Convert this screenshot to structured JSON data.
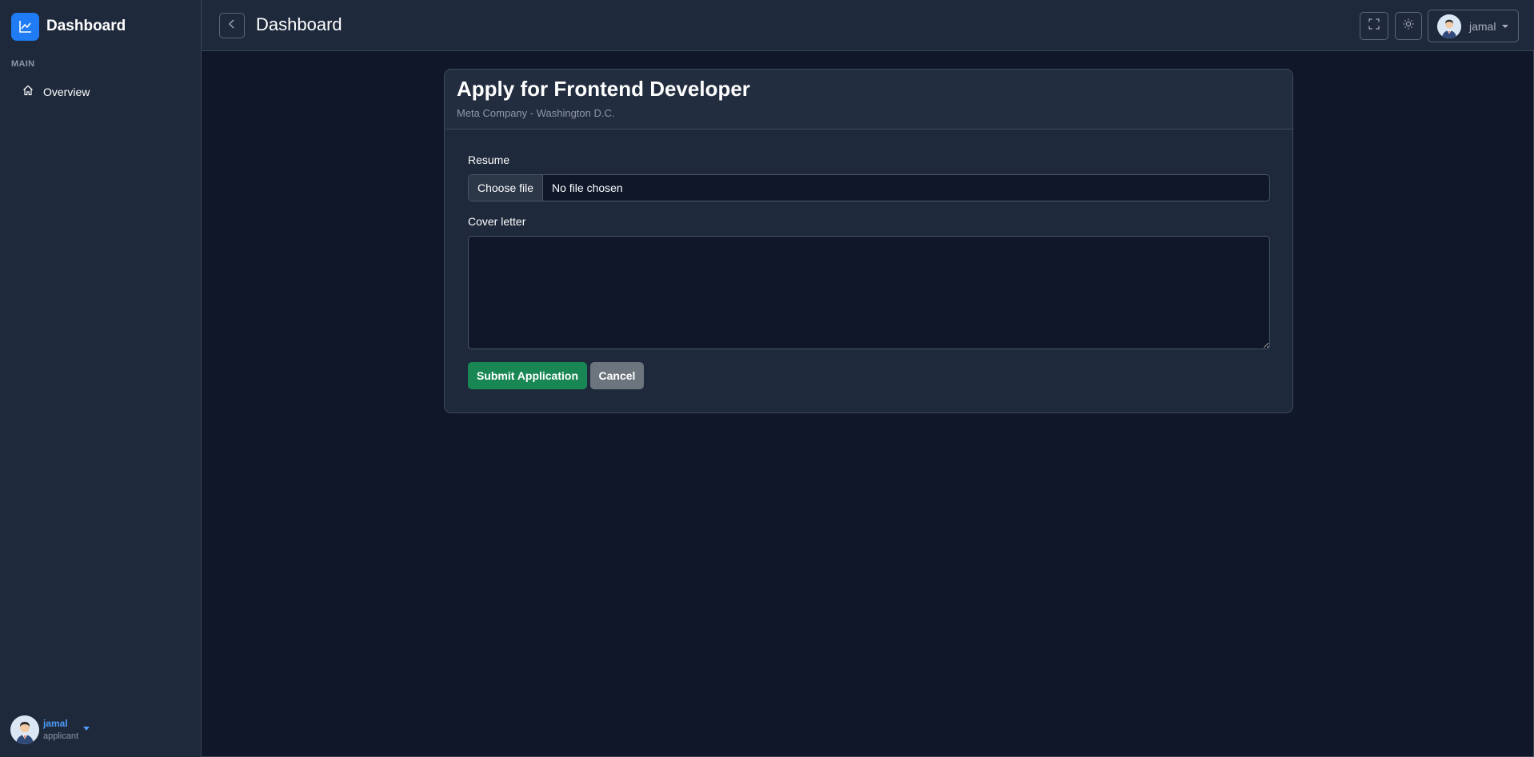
{
  "brand": {
    "title": "Dashboard",
    "logo_icon": "chart-line-icon",
    "accent": "#1f7cf5"
  },
  "sidebar": {
    "section_label": "MAIN",
    "items": [
      {
        "label": "Overview",
        "icon": "home-icon"
      }
    ],
    "user": {
      "name": "jamal",
      "role": "applicant"
    }
  },
  "header": {
    "title": "Dashboard",
    "back_icon": "chevron-left-icon",
    "fullscreen_icon": "fullscreen-icon",
    "theme_icon": "sun-icon",
    "user_name": "jamal"
  },
  "form": {
    "title": "Apply for Frontend Developer",
    "subtitle": "Meta Company - Washington D.C.",
    "resume_label": "Resume",
    "file_button": "Choose file",
    "file_status": "No file chosen",
    "cover_letter_label": "Cover letter",
    "cover_letter_value": "",
    "submit_label": "Submit Application",
    "cancel_label": "Cancel",
    "submit_color": "#198754",
    "cancel_color": "#6c757d"
  }
}
